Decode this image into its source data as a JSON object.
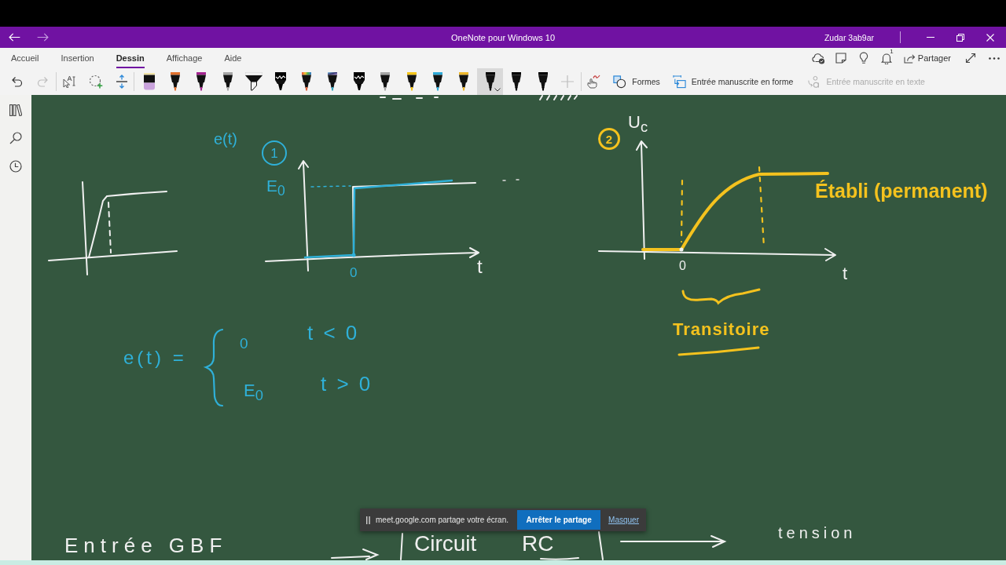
{
  "title_bar": {
    "back": {
      "disabled": false
    },
    "forward": {
      "disabled": true
    },
    "title": "OneNote pour Windows 10",
    "user": "Zudar 3ab9ar"
  },
  "ribbon": {
    "tabs": [
      {
        "label": "Accueil",
        "selected": false
      },
      {
        "label": "Insertion",
        "selected": false
      },
      {
        "label": "Dessin",
        "selected": true
      },
      {
        "label": "Affichage",
        "selected": false
      },
      {
        "label": "Aide",
        "selected": false
      }
    ],
    "notification_count": "1",
    "share_label": "Partager"
  },
  "toolbar": {
    "undo": {
      "disabled": false
    },
    "redo": {
      "disabled": true
    },
    "pens": [
      {
        "kind": "eraser",
        "color": "#c9a3dc",
        "selected": false
      },
      {
        "kind": "pen",
        "color": "#e2712e",
        "selected": false
      },
      {
        "kind": "pen",
        "color": "#a3238f",
        "selected": false
      },
      {
        "kind": "pen",
        "color": "#a6a6a6",
        "selected": false
      },
      {
        "kind": "highlighter",
        "color": "#f2f2f2",
        "selected": false
      },
      {
        "kind": "textured",
        "color": "#000000",
        "selected": false
      },
      {
        "kind": "rainbow",
        "selected": false
      },
      {
        "kind": "galaxy",
        "selected": false
      },
      {
        "kind": "textured",
        "color": "#000000",
        "selected": false
      },
      {
        "kind": "pen",
        "color": "#a6a6a6",
        "selected": false
      },
      {
        "kind": "pen",
        "color": "#f5c518",
        "selected": false
      },
      {
        "kind": "pen",
        "color": "#2eaad8",
        "selected": false
      },
      {
        "kind": "pen",
        "color": "#eeb82c",
        "selected": false
      },
      {
        "kind": "pen",
        "color": "#000000",
        "selected": true
      },
      {
        "kind": "pen",
        "color": "#000000",
        "selected": false
      },
      {
        "kind": "pen",
        "color": "#000000",
        "selected": false
      }
    ],
    "add_pen": {
      "disabled": true
    },
    "commands": [
      {
        "kind": "shapes",
        "label": "Formes",
        "disabled": false
      },
      {
        "kind": "ink-to-shape",
        "label": "Entrée manuscrite en forme",
        "disabled": false
      },
      {
        "kind": "ink-to-text",
        "label": "Entrée manuscrite en texte",
        "disabled": true
      }
    ]
  },
  "canvas": {
    "step_graph": {
      "function_label": "e(t)",
      "number": "1",
      "level_label": "E$_{0}$",
      "origin_label": "0",
      "axis_label": "t"
    },
    "equation": {
      "lhs": "e(t) =",
      "cases": [
        {
          "value": "0",
          "condition": "t < 0"
        },
        {
          "value": "E$_{0}$",
          "condition": "t > 0"
        }
      ]
    },
    "charging_graph": {
      "number": "2",
      "axis_y_label": "U$_{c}$",
      "origin_label": "0",
      "axis_label": "t",
      "steady_label": "Établi (permanent)",
      "transient_label": "Transitoire"
    },
    "block_diagram": {
      "input_label": "Entrée GBF",
      "block_label": "Circuit RC",
      "output_label": "tension"
    }
  },
  "share_banner": {
    "message": "meet.google.com partage votre écran.",
    "stop_button": "Arrêter le partage",
    "hide_link": "Masquer"
  }
}
